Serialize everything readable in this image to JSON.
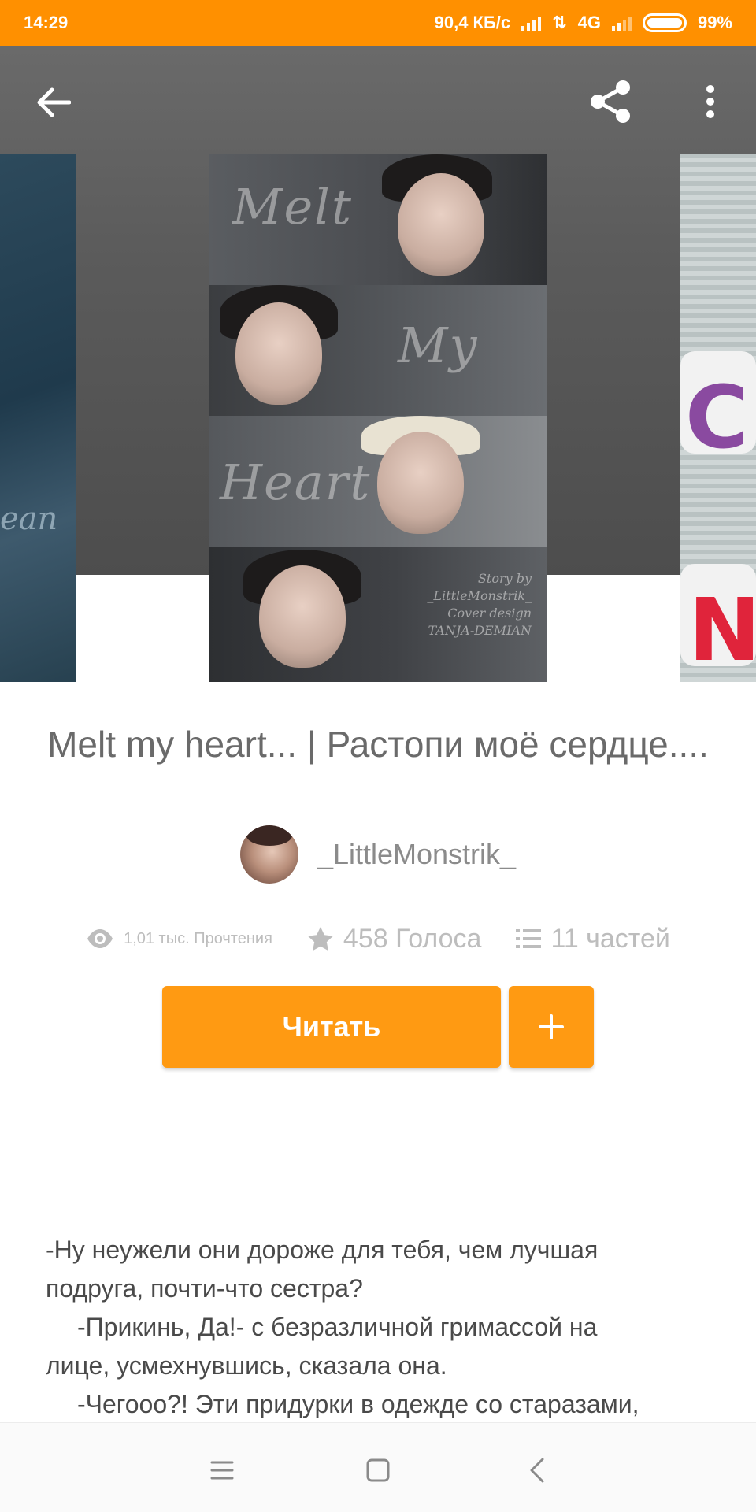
{
  "status_bar": {
    "time": "14:29",
    "network_speed": "90,4 КБ/с",
    "network_type": "4G",
    "battery": "99%",
    "battery_level": 0.99,
    "background_color": "#ff9000"
  },
  "toolbar": {
    "back_icon": "arrow-left-icon",
    "share_icon": "share-icon",
    "more_icon": "more-vertical-icon"
  },
  "cover": {
    "script_words": [
      "Melt",
      "My",
      "Heart"
    ],
    "credit_lines": [
      "Story by",
      "_LittleMonstrik_",
      "Cover design",
      "TANJA-DEMIAN"
    ]
  },
  "story": {
    "title": "Melt my heart... | Растопи моё сердце....",
    "author": "_LittleMonstrik_"
  },
  "stats": {
    "reads": "1,01 тыс. Прочтения",
    "votes": "458 Голоса",
    "parts": "11 частей",
    "icon_color": "#bdbdbd"
  },
  "actions": {
    "read_label": "Читать",
    "add_label": "+",
    "accent_color": "#ff9a12"
  },
  "excerpt": {
    "lines": [
      "-Ну неужели они дороже для тебя, чем лучшая",
      "подруга, почти-что сестра?",
      "-Прикинь, Да!- с безразличной гримассой на",
      "лице, усмехнувшись, сказала она.",
      "-Чегооо?! Эти придурки в одежде со старазами,"
    ]
  },
  "nav_bar": {
    "menu_icon": "menu-icon",
    "home_icon": "home-square-icon",
    "back_icon": "chevron-left-icon"
  }
}
